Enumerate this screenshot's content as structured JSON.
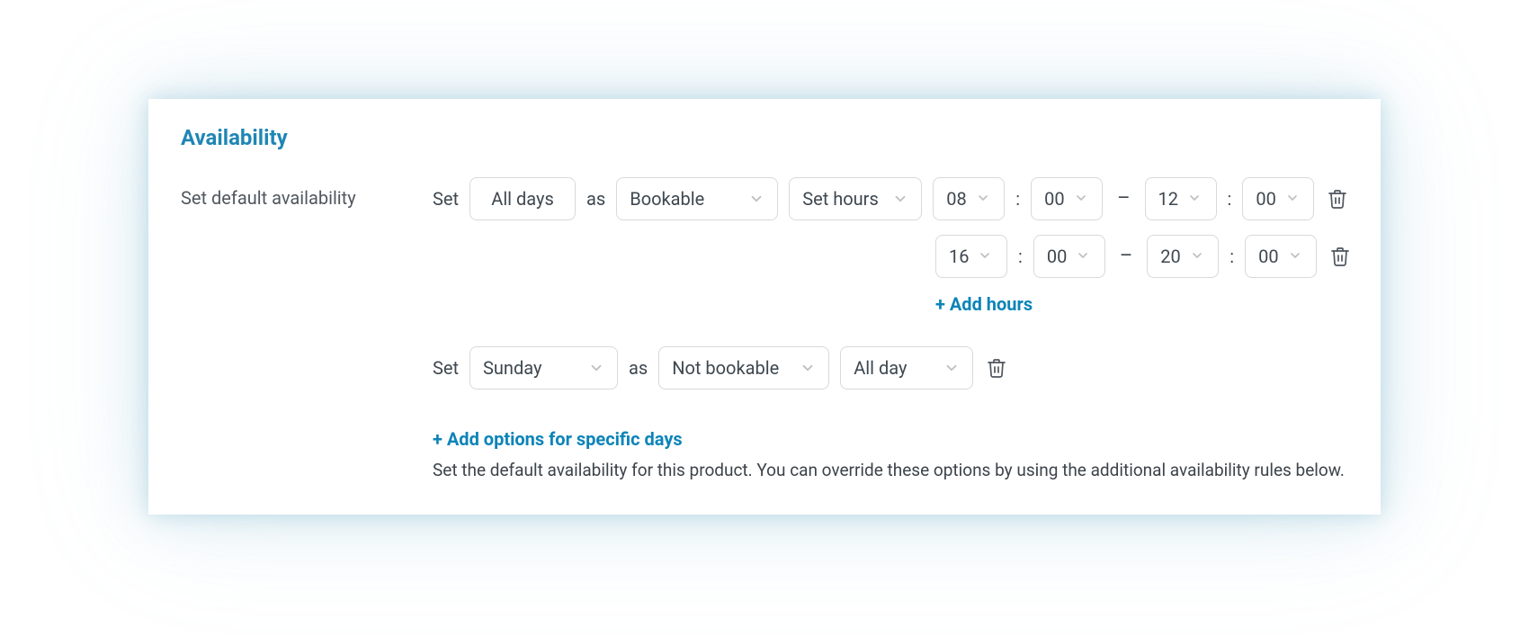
{
  "section": {
    "title": "Availability",
    "label": "Set default availability"
  },
  "words": {
    "set": "Set",
    "as": "as",
    "colon": ":",
    "dash": "–"
  },
  "rules": [
    {
      "day": "All days",
      "dayHasChevron": false,
      "status": "Bookable",
      "hoursMode": "Set hours",
      "hours": [
        {
          "fromH": "08",
          "fromM": "00",
          "toH": "12",
          "toM": "00"
        },
        {
          "fromH": "16",
          "fromM": "00",
          "toH": "20",
          "toM": "00"
        }
      ],
      "addHours": "+ Add hours",
      "showAddHours": true
    },
    {
      "day": "Sunday",
      "dayHasChevron": true,
      "status": "Not bookable",
      "hoursMode": "All day",
      "hours": [],
      "addHours": "",
      "showAddHours": false
    }
  ],
  "footer": {
    "addOptions": "+ Add options for specific days",
    "helper": "Set the default availability for this product. You can override these options by using the additional availability rules below."
  }
}
